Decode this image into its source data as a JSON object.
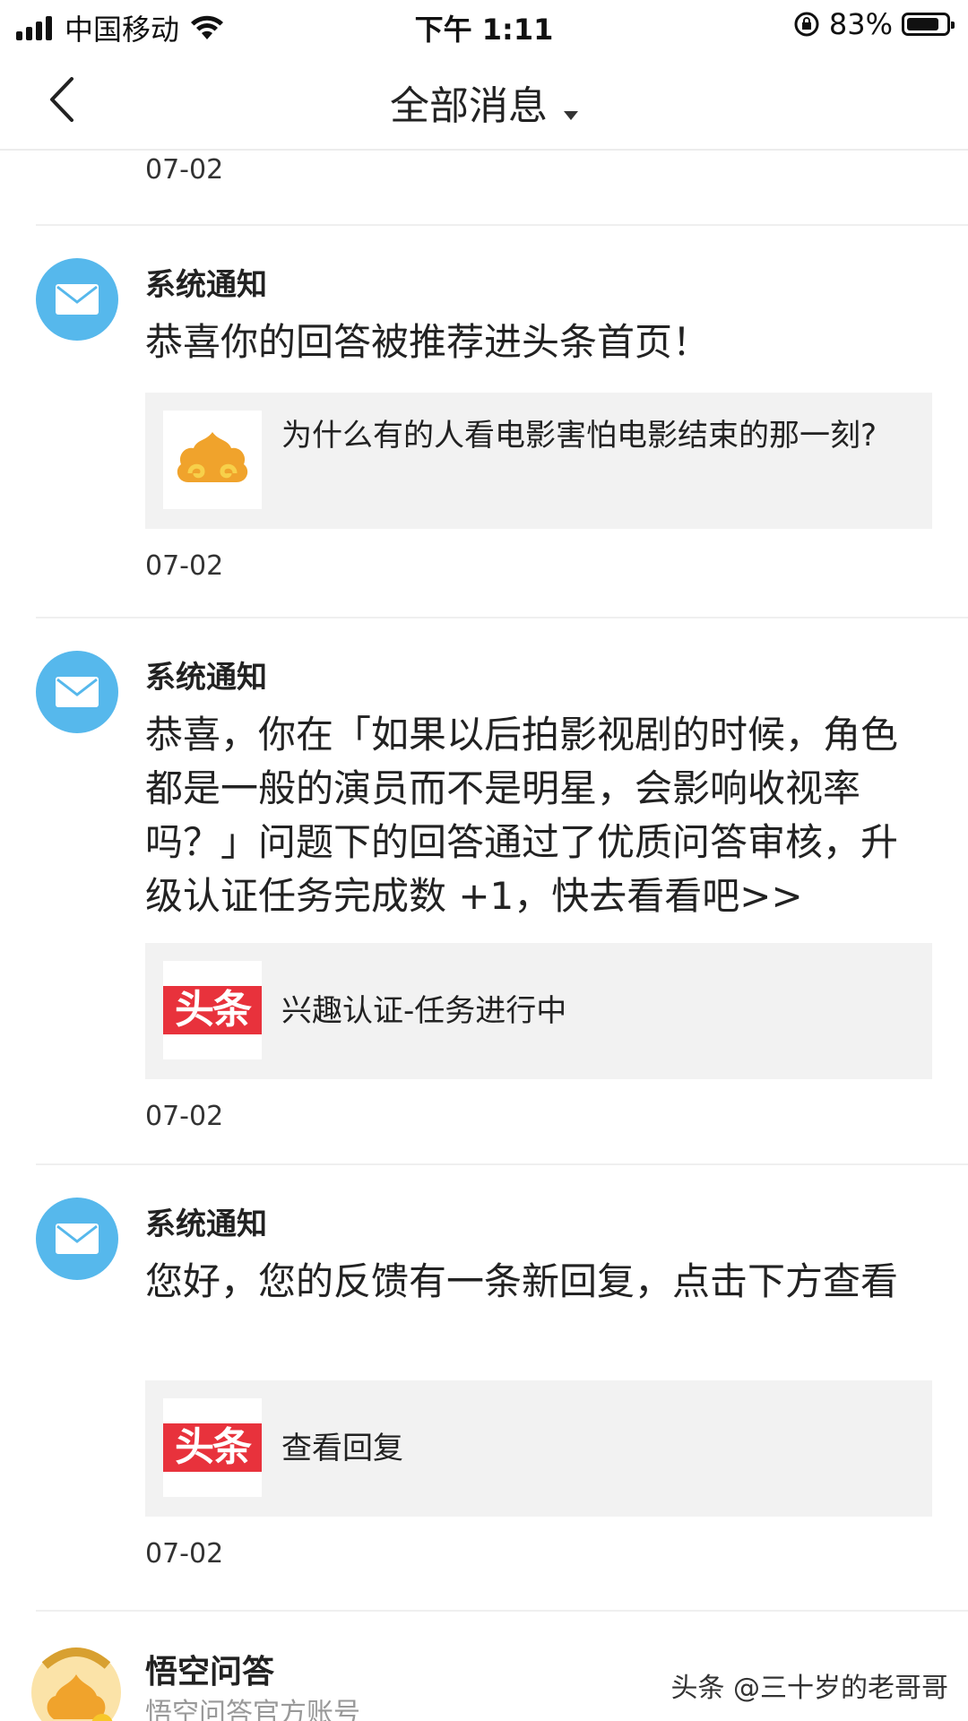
{
  "status_bar": {
    "carrier": "中国移动",
    "time": "下午 1:11",
    "battery": "83%",
    "battery_level": 0.83
  },
  "nav": {
    "title": "全部消息"
  },
  "feed": {
    "top_date": "07-02",
    "messages": [
      {
        "sender": "系统通知",
        "body": "恭喜你的回答被推荐进头条首页！",
        "card_text": "为什么有的人看电影害怕电影结束的那一刻?",
        "date": "07-02",
        "thumb_icon": "wukong-cloud-icon"
      },
      {
        "sender": "系统通知",
        "body": "恭喜，你在「如果以后拍影视剧的时候，角色都是一般的演员而不是明星，会影响收视率吗？」问题下的回答通过了优质问答审核，升级认证任务完成数 +1，快去看看吧>>",
        "card_text": "兴趣认证-任务进行中",
        "card_logo_text": "头条",
        "date": "07-02",
        "thumb_icon": "toutiao-logo-icon"
      },
      {
        "sender": "系统通知",
        "body": "您好，您的反馈有一条新回复，点击下方查看",
        "card_text": "查看回复",
        "card_logo_text": "头条",
        "date": "07-02",
        "thumb_icon": "toutiao-logo-icon"
      }
    ],
    "partial_item": {
      "name": "悟空问答",
      "subtitle": "悟空问答官方账号"
    }
  },
  "watermark": "头条 @三十岁的老哥哥",
  "colors": {
    "avatar_blue": "#56b8ec",
    "toutiao_red": "#e8323c",
    "card_bg": "#f2f2f2"
  }
}
